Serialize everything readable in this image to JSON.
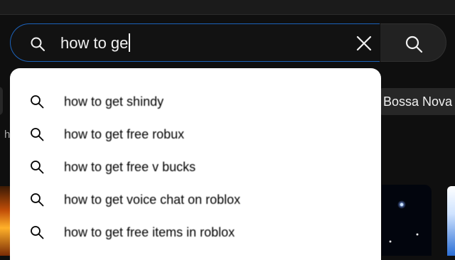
{
  "search": {
    "query": "how to ge",
    "icons": {
      "left": "search-icon",
      "clear": "close-icon",
      "submit": "search-icon"
    }
  },
  "suggestions": [
    {
      "text": "how to get shindy",
      "icon": "search-icon"
    },
    {
      "text": "how to get free robux",
      "icon": "search-icon"
    },
    {
      "text": "how to get free v bucks",
      "icon": "search-icon"
    },
    {
      "text": "how to get voice chat on roblox",
      "icon": "search-icon"
    },
    {
      "text": "how to get free items in roblox",
      "icon": "search-icon"
    }
  ],
  "background": {
    "chip_right": "Bossa Nova",
    "peek_text": "h"
  },
  "colors": {
    "page_bg": "#0f0f0f",
    "focus_border": "#1c62b9",
    "dropdown_bg": "#ffffff",
    "search_button_bg": "#222222"
  }
}
